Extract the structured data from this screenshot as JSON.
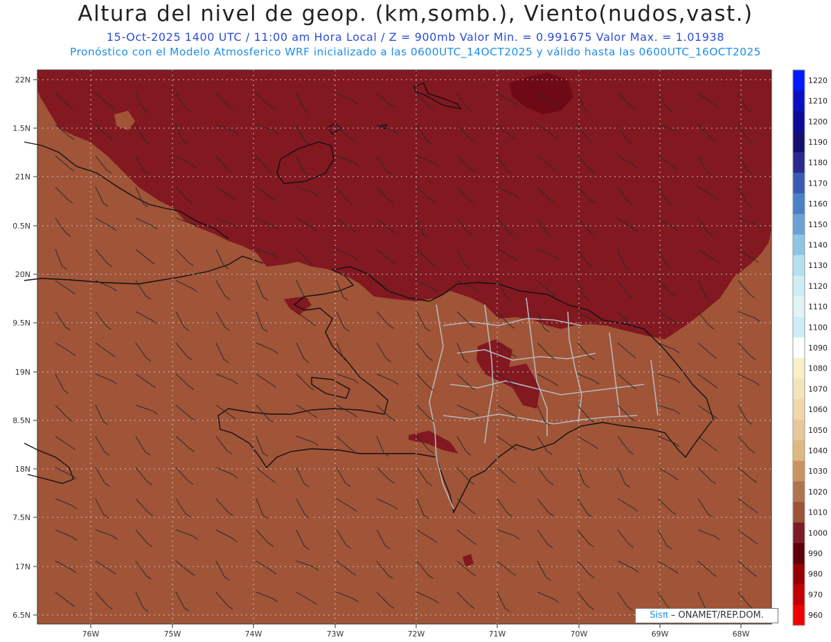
{
  "header": {
    "title": "Altura del nivel de geop. (km,somb.), Viento(nudos,vast.)",
    "subtitle": "15-Oct-2025  1400 UTC / 11:00 am Hora Local / Z = 900mb   Valor Min. = 0.991675   Valor Max. = 1.01938",
    "model_line": "Pronóstico con el Modelo Atmosferico WRF inicializado a las 0600UTC_14OCT2025 y válido hasta las  0600UTC_16OCT2025"
  },
  "map": {
    "lat_labels": [
      "22N",
      "1.5N",
      "21N",
      "0.5N",
      "20N",
      "9.5N",
      "19N",
      "8.5N",
      "18N",
      "7.5N",
      "17N",
      "6.5N"
    ],
    "lon_labels": [
      "76W",
      "75W",
      "74W",
      "73W",
      "72W",
      "71W",
      "70W",
      "69W",
      "68W"
    ],
    "colors": {
      "low_band": "#821820",
      "main_band": "#a05438",
      "coast": "#111111",
      "borders": "#b0b0b0"
    }
  },
  "colorbar": {
    "labels": [
      "1220",
      "1210",
      "1200",
      "1190",
      "1180",
      "1170",
      "1160",
      "1150",
      "1140",
      "1130",
      "1120",
      "1110",
      "1100",
      "1090",
      "1080",
      "1070",
      "1060",
      "1050",
      "1040",
      "1030",
      "1020",
      "1010",
      "1000",
      "990",
      "980",
      "970",
      "960"
    ],
    "colors": [
      "#0019ff",
      "#0a10c0",
      "#0c0c98",
      "#14106e",
      "#2a2a8c",
      "#3a5ab4",
      "#4a80c4",
      "#6aa0d4",
      "#8ec4e4",
      "#b4e0ee",
      "#cfeef4",
      "#e0f4f6",
      "#cdeef6",
      "#ffffff",
      "#f8f0c8",
      "#f4e4bc",
      "#f0d8ac",
      "#e8c898",
      "#deb882",
      "#c89560",
      "#b0744c",
      "#9c5438",
      "#7c1c24",
      "#5e0008",
      "#960000",
      "#c40000",
      "#f00000"
    ]
  },
  "credit": {
    "brand": "Sisπ",
    "text": " –  ONAMET/REP.DOM."
  }
}
